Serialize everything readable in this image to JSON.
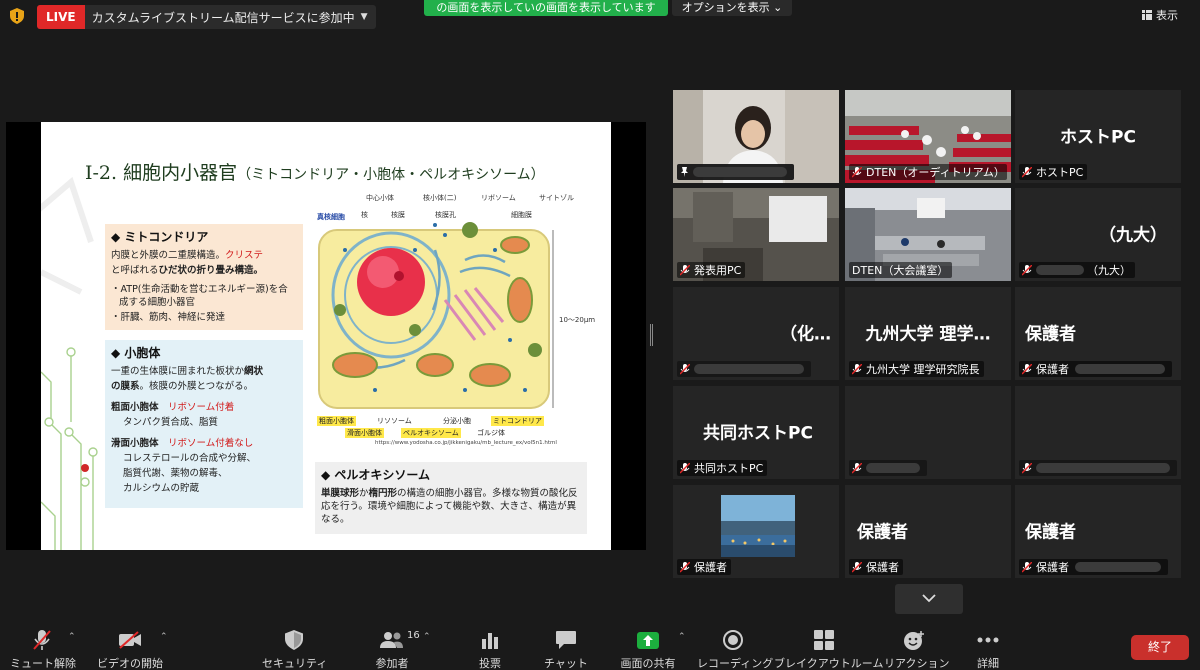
{
  "live": {
    "badge": "LIVE",
    "text": "カスタムライブストリーム配信サービスに参加中"
  },
  "share_banner": {
    "text": "の画面を表示していの画面を表示しています",
    "options": "オプションを表示"
  },
  "view_button": {
    "label": "表示"
  },
  "slide": {
    "title_main": "Ⅰ-2. 細胞内小器官",
    "title_sub": "（ミトコンドリア・小胞体・ペルオキシソーム）",
    "mito": {
      "heading": "◆ ミトコンドリア",
      "line1a": "内膜と外膜の二重膜構造。",
      "line1b": "クリステ",
      "line2a": "と呼ばれる",
      "line2b": "ひだ状の折り畳み構造。",
      "bullet1": "・ATP(生命活動を営むエネルギー源)を合成する細胞小器官",
      "bullet2": "・肝臓、筋肉、神経に発達"
    },
    "vesicle": {
      "heading": "◆ 小胞体",
      "line1a": "一重の生体膜に囲まれた板状か",
      "line1b": "網状",
      "line2a": "の膜系",
      "line2b": "。核膜の外膜とつながる。",
      "rough_label": "粗面小胞体",
      "rough_tag": "リボソーム付着",
      "rough_desc": "タンパク質合成、脂質",
      "smooth_label": "滑面小胞体",
      "smooth_tag": "リボソーム付着なし",
      "smooth_desc1": "コレステロールの合成や分解、",
      "smooth_desc2": "脂質代謝、薬物の解毒、",
      "smooth_desc3": "カルシウムの貯蔵"
    },
    "peroxisome": {
      "heading": "◆ ペルオキシソーム",
      "b1": "単膜球形",
      "t1": "か",
      "b2": "楕円形",
      "t2": "の構造の細胞小器官。多様な物質の酸化反応を行う。環境や細胞によって機能や数、大きさ、構造が異なる。"
    },
    "diagram": {
      "cell_type": "真核細胞",
      "top_labels": [
        "中心小体",
        "核小体(二)",
        "リボソーム",
        "サイトゾル"
      ],
      "second_labels": [
        "核",
        "核膜",
        "核膜孔",
        "細胞膜"
      ],
      "bottom_row1": [
        "粗面小胞体",
        "リソソーム",
        "分泌小胞",
        "ミトコンドリア"
      ],
      "bottom_row2": [
        "滑面小胞体",
        "ペルオキシソーム",
        "ゴルジ体"
      ],
      "scale": "10〜20μm",
      "url": "https://www.yodosha.co.jp/jikkenigaku/mb_lecture_ex/vol5n1.html"
    }
  },
  "participants": [
    {
      "name": "",
      "big": ""
    },
    {
      "name": "DTEN（オーディトリアム）",
      "big": ""
    },
    {
      "name": "ホストPC",
      "big": "ホストPC"
    },
    {
      "name": "発表用PC",
      "big": ""
    },
    {
      "name": "DTEN（大会議室）",
      "big": ""
    },
    {
      "name": "（九大）",
      "big": "（九大）"
    },
    {
      "name": "",
      "big": "（化…"
    },
    {
      "name": "九州大学 理学研究院長",
      "big": "九州大学 理学…"
    },
    {
      "name": "保護者",
      "big": "保護者"
    },
    {
      "name": "共同ホストPC",
      "big": "共同ホストPC"
    },
    {
      "name": "",
      "big": ""
    },
    {
      "name": "",
      "big": ""
    },
    {
      "name": "保護者",
      "big": ""
    },
    {
      "name": "保護者",
      "big": "保護者"
    },
    {
      "name": "保護者",
      "big": "保護者"
    }
  ],
  "toolbar": {
    "unmute": "ミュート解除",
    "start_video": "ビデオの開始",
    "security": "セキュリティ",
    "participants": "参加者",
    "participants_count": "16",
    "polls": "投票",
    "chat": "チャット",
    "share": "画面の共有",
    "record": "レコーディング",
    "breakout": "ブレイクアウトルーム",
    "reactions": "リアクション",
    "more": "詳細",
    "end": "終了"
  }
}
